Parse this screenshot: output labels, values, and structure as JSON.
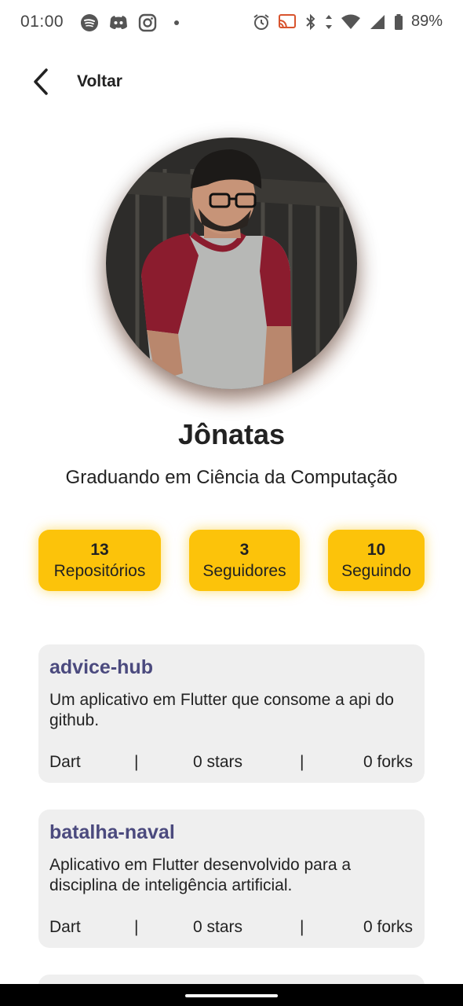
{
  "status_bar": {
    "time": "01:00",
    "battery": "89%",
    "left_icons": [
      "spotify-icon",
      "discord-icon",
      "instagram-icon",
      "dot-icon"
    ],
    "right_icons": [
      "alarm-icon",
      "cast-icon",
      "bluetooth-icon",
      "data-arrows-icon",
      "wifi-icon",
      "signal-icon",
      "battery-icon"
    ]
  },
  "header": {
    "back_label": "Voltar"
  },
  "profile": {
    "name": "Jônatas",
    "bio": "Graduando em Ciência da Computação"
  },
  "stats": [
    {
      "count": "13",
      "label": "Repositórios"
    },
    {
      "count": "3",
      "label": "Seguidores"
    },
    {
      "count": "10",
      "label": "Seguindo"
    }
  ],
  "repos": [
    {
      "name": "advice-hub",
      "description": "Um aplicativo em Flutter que consome a api do github.",
      "language": "Dart",
      "separator": "|",
      "stars": "0 stars",
      "forks": "0 forks"
    },
    {
      "name": "batalha-naval",
      "description": "Aplicativo em Flutter desenvolvido para a disciplina de inteligência artificial.",
      "language": "Dart",
      "separator": "|",
      "stars": "0 stars",
      "forks": "0 forks"
    }
  ],
  "colors": {
    "accent": "#fcc30a",
    "repo_title": "#4b4a7e",
    "card_bg": "#efefef"
  }
}
